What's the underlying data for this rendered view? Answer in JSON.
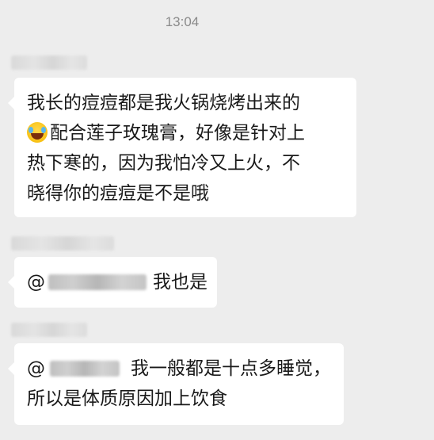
{
  "timestamp": "13:04",
  "messages": [
    {
      "lines": [
        "我长的痘痘都是我火锅烧烤出来的",
        "配合莲子玫瑰膏，好像是针对上",
        "热下寒的，因为我怕冷又上火，不",
        "晓得你的痘痘是不是哦"
      ],
      "emoji": "grinning-sweat-emoji"
    },
    {
      "mention_prefix": "@",
      "text": "我也是"
    },
    {
      "mention_prefix": "@",
      "lines": [
        "我一般都是十点多睡觉，",
        "所以是体质原因加上饮食"
      ]
    }
  ]
}
